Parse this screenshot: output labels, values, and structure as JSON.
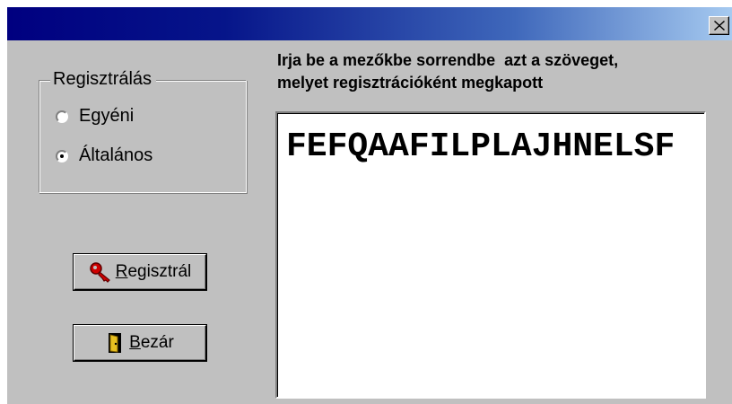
{
  "titlebar": {
    "title": "",
    "close_icon": "close-icon"
  },
  "registration_group": {
    "legend": "Regisztrálás",
    "options": [
      {
        "label": "Egyéni",
        "selected": false
      },
      {
        "label": "Általános",
        "selected": true
      }
    ]
  },
  "buttons": {
    "register": {
      "label": "Regisztrál",
      "icon": "key-icon"
    },
    "close": {
      "label": "Bezár",
      "icon": "door-icon"
    }
  },
  "instructions": {
    "line1": "Irja be a mezőkbe sorrendbe  azt a szöveget,",
    "line2": "melyet regisztrációként megkapott"
  },
  "registration_code": "FEFQAAFILPLAJHNELSF",
  "colors": {
    "window_bg": "#c0c0c0",
    "titlebar_start": "#000080",
    "titlebar_end": "#a6caf0",
    "textbox_bg": "#ffffff"
  }
}
